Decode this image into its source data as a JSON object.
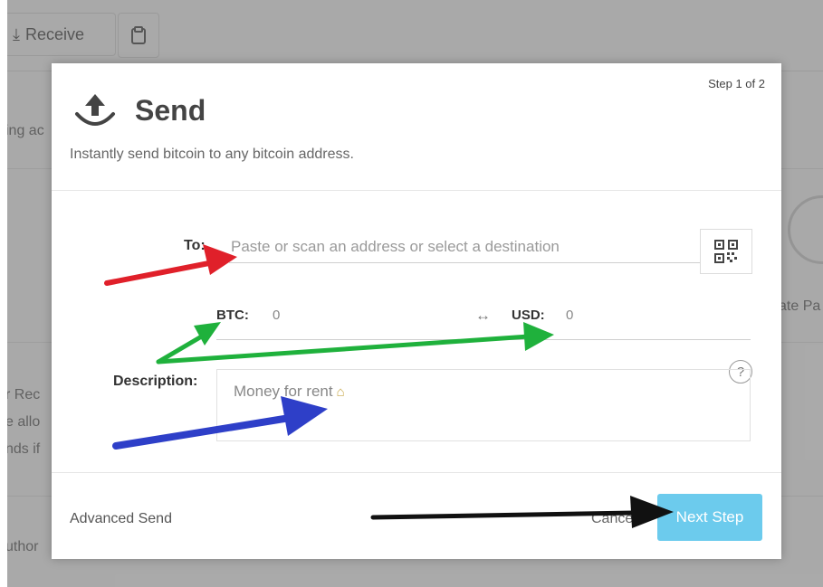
{
  "background": {
    "toolbar": {
      "receive_label": "Receive"
    },
    "snippets": [
      "ing ac",
      "ate Pa",
      "r Rec",
      "e allo",
      "nds if",
      "uthor"
    ]
  },
  "modal": {
    "step": "Step 1 of 2",
    "title": "Send",
    "subtitle": "Instantly send bitcoin to any bitcoin address.",
    "to": {
      "label": "To:",
      "placeholder": "Paste or scan an address or select a destination",
      "value": ""
    },
    "btc": {
      "label": "BTC:",
      "value": "0"
    },
    "usd": {
      "label": "USD:",
      "value": "0"
    },
    "swap_glyph": "↔",
    "description": {
      "label": "Description:",
      "value": "Money for rent",
      "emoji": "house-icon"
    },
    "help_glyph": "?",
    "footer": {
      "advanced_label": "Advanced Send",
      "cancel_label": "Cancel",
      "next_label": "Next Step"
    }
  },
  "colors": {
    "next_button": "#6ccbed",
    "arrow_red": "#e0202a",
    "arrow_green": "#1fb13c",
    "arrow_blue": "#2e3fc8",
    "arrow_black": "#111111"
  }
}
